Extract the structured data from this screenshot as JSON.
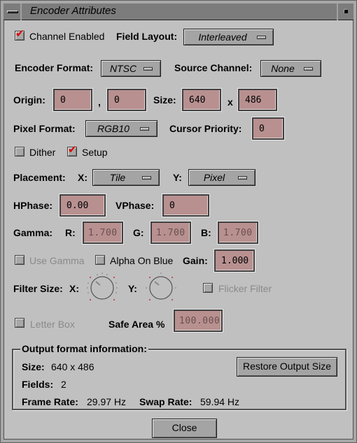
{
  "window": {
    "title": "Encoder Attributes"
  },
  "row1": {
    "channel_enabled": {
      "label": "Channel Enabled",
      "checked": true
    },
    "field_layout": {
      "label": "Field Layout:",
      "value": "Interleaved"
    }
  },
  "row2": {
    "encoder_format": {
      "label": "Encoder Format:",
      "value": "NTSC"
    },
    "source_channel": {
      "label": "Source Channel:",
      "value": "None"
    }
  },
  "row3": {
    "origin_label": "Origin:",
    "origin_x": "0",
    "comma": ",",
    "origin_y": "0",
    "size_label": "Size:",
    "size_w": "640",
    "x_sep": "x",
    "size_h": "486"
  },
  "row4": {
    "pixel_format": {
      "label": "Pixel Format:",
      "value": "RGB10"
    },
    "cursor_priority": {
      "label": "Cursor Priority:",
      "value": "0"
    }
  },
  "row5": {
    "dither": {
      "label": "Dither",
      "checked": false
    },
    "setup": {
      "label": "Setup",
      "checked": true
    }
  },
  "row6": {
    "placement_label": "Placement:",
    "x_label": "X:",
    "x_value": "Tile",
    "y_label": "Y:",
    "y_value": "Pixel"
  },
  "row7": {
    "hphase_label": "HPhase:",
    "hphase_value": "0.00",
    "vphase_label": "VPhase:",
    "vphase_value": "0"
  },
  "row8": {
    "gamma_label": "Gamma:",
    "r_label": "R:",
    "r_value": "1.700",
    "g_label": "G:",
    "g_value": "1.700",
    "b_label": "B:",
    "b_value": "1.700"
  },
  "row9": {
    "use_gamma": {
      "label": "Use Gamma",
      "checked": false,
      "enabled": false
    },
    "alpha_on_blue": {
      "label": "Alpha On Blue",
      "checked": false
    },
    "gain_label": "Gain:",
    "gain_value": "1.000"
  },
  "row10": {
    "filter_size_label": "Filter Size:",
    "x_label": "X:",
    "y_label": "Y:",
    "flicker_filter": {
      "label": "Flicker Filter",
      "checked": false,
      "enabled": false
    }
  },
  "row11": {
    "letter_box": {
      "label": "Letter Box",
      "checked": false,
      "enabled": false
    },
    "safe_area_label": "Safe Area %",
    "safe_area_value": "100.000"
  },
  "output_info": {
    "title": "Output format information:",
    "size_label": "Size:",
    "size_value": "640 x 486",
    "fields_label": "Fields:",
    "fields_value": "2",
    "frame_rate_label": "Frame Rate:",
    "frame_rate_value": "29.97 Hz",
    "swap_rate_label": "Swap Rate:",
    "swap_rate_value": "59.94 Hz",
    "restore_button": "Restore Output Size"
  },
  "footer": {
    "close_button": "Close"
  },
  "colors": {
    "background": "#c0c0c0",
    "titlebar": "#7c7c7c",
    "field_bg": "#b89090",
    "check_mark": "#e00000",
    "button_bg": "#a4a4a4"
  }
}
